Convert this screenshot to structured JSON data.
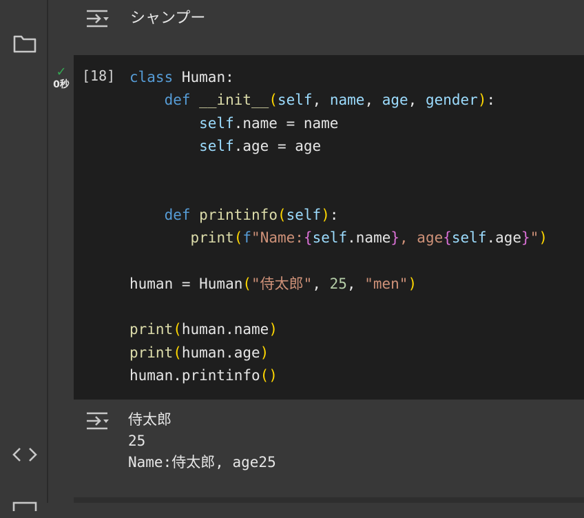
{
  "top_output": {
    "text": "シャンプー"
  },
  "cell": {
    "execution_count": "[18]",
    "status_time": "0秒",
    "code_lines": [
      [
        [
          "kw",
          "class"
        ],
        [
          "plain",
          " "
        ],
        [
          "cls",
          "Human"
        ],
        [
          "plain",
          ":"
        ]
      ],
      [
        [
          "plain",
          "    "
        ],
        [
          "kw",
          "def"
        ],
        [
          "plain",
          " "
        ],
        [
          "fn",
          "__init__"
        ],
        [
          "par1",
          "("
        ],
        [
          "sf",
          "self"
        ],
        [
          "plain",
          ", "
        ],
        [
          "param",
          "name"
        ],
        [
          "plain",
          ", "
        ],
        [
          "param",
          "age"
        ],
        [
          "plain",
          ", "
        ],
        [
          "param",
          "gender"
        ],
        [
          "par1",
          ")"
        ],
        [
          "plain",
          ":"
        ]
      ],
      [
        [
          "plain",
          "        "
        ],
        [
          "sf",
          "self"
        ],
        [
          "plain",
          ".name = name"
        ]
      ],
      [
        [
          "plain",
          "        "
        ],
        [
          "sf",
          "self"
        ],
        [
          "plain",
          ".age = age"
        ]
      ],
      [],
      [],
      [
        [
          "plain",
          "    "
        ],
        [
          "kw",
          "def"
        ],
        [
          "plain",
          " "
        ],
        [
          "fn",
          "printinfo"
        ],
        [
          "par1",
          "("
        ],
        [
          "sf",
          "self"
        ],
        [
          "par1",
          ")"
        ],
        [
          "plain",
          ":"
        ]
      ],
      [
        [
          "plain",
          "       "
        ],
        [
          "fn",
          "print"
        ],
        [
          "par1",
          "("
        ],
        [
          "kw",
          "f"
        ],
        [
          "str",
          "\"Name:"
        ],
        [
          "par2",
          "{"
        ],
        [
          "sf",
          "self"
        ],
        [
          "plain",
          ".name"
        ],
        [
          "par2",
          "}"
        ],
        [
          "str",
          ", age"
        ],
        [
          "par2",
          "{"
        ],
        [
          "sf",
          "self"
        ],
        [
          "plain",
          ".age"
        ],
        [
          "par2",
          "}"
        ],
        [
          "str",
          "\""
        ],
        [
          "par1",
          ")"
        ]
      ],
      [],
      [
        [
          "plain",
          "human = Human"
        ],
        [
          "par1",
          "("
        ],
        [
          "str",
          "\"侍太郎\""
        ],
        [
          "plain",
          ", "
        ],
        [
          "num",
          "25"
        ],
        [
          "plain",
          ", "
        ],
        [
          "str",
          "\"men\""
        ],
        [
          "par1",
          ")"
        ]
      ],
      [],
      [
        [
          "fn",
          "print"
        ],
        [
          "par1",
          "("
        ],
        [
          "plain",
          "human.name"
        ],
        [
          "par1",
          ")"
        ]
      ],
      [
        [
          "fn",
          "print"
        ],
        [
          "par1",
          "("
        ],
        [
          "plain",
          "human.age"
        ],
        [
          "par1",
          ")"
        ]
      ],
      [
        [
          "plain",
          "human.printinfo"
        ],
        [
          "par1",
          "()"
        ]
      ]
    ]
  },
  "bottom_output": {
    "lines": [
      "侍太郎",
      "25",
      "Name:侍太郎, age25"
    ]
  },
  "icons": {
    "sidebar_top": "folder-icon",
    "sidebar_bottom": "code-icon",
    "output": "output-toggle-icon",
    "status": "check-icon"
  }
}
